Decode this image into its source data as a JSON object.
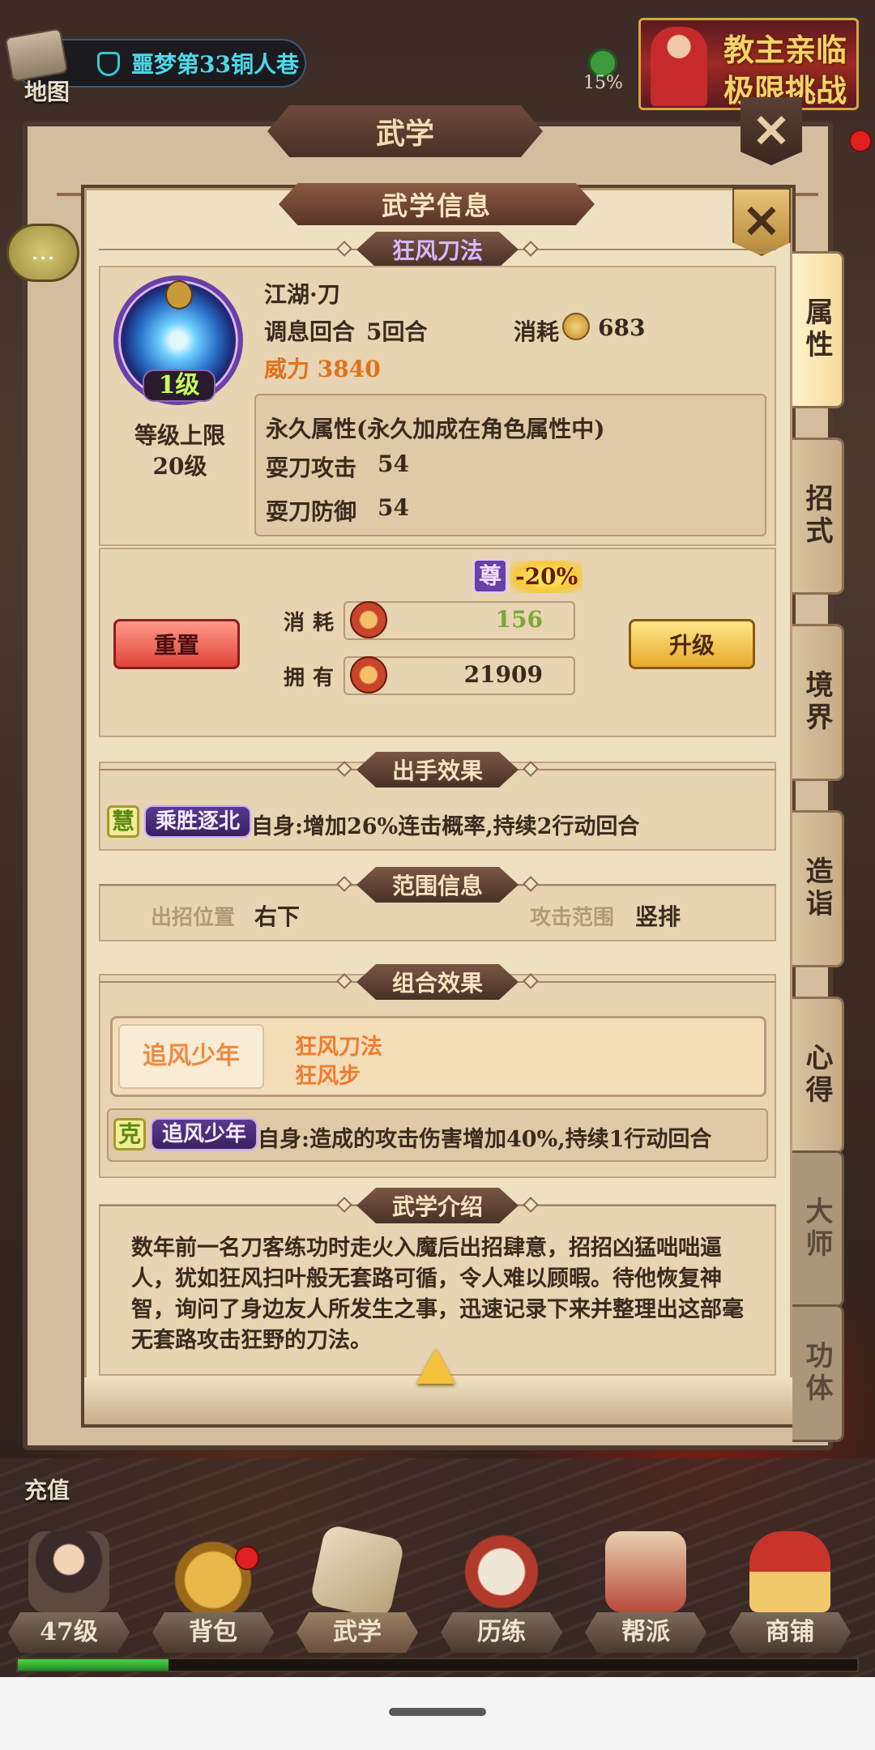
{
  "hud": {
    "map_label": "地图",
    "location": "噩梦第33铜人巷",
    "percent": "15%",
    "event_line1": "教主亲临",
    "event_line2": "极限挑战",
    "recharge_label": "充值",
    "chat_icon": "…"
  },
  "back_window": {
    "title": "武学",
    "close_symbol": "✕"
  },
  "dialog": {
    "title": "武学信息",
    "close_symbol": "✕",
    "skill_name": "狂风刀法",
    "info": {
      "level_badge": "1级",
      "level_cap_label": "等级上限",
      "level_cap_value": "20级",
      "school": "江湖·刀",
      "breath_label": "调息回合",
      "breath_value": "5回合",
      "cost_label": "消耗",
      "cost_value": "683",
      "power": "威力 3840",
      "permanent_title": "永久属性(永久加成在角色属性中)",
      "stat1_label": "耍刀攻击",
      "stat1_value": "54",
      "stat2_label": "耍刀防御",
      "stat2_value": "54"
    },
    "upgrade": {
      "reset_label": "重置",
      "upgrade_label": "升级",
      "rank_badge": "尊",
      "discount": "-20%",
      "consume_label": "消耗",
      "consume_value": "156",
      "own_label": "拥有",
      "own_value": "21909"
    },
    "attack_effect": {
      "header": "出手效果",
      "tag_char": "慧",
      "tag_name": "乘胜逐北",
      "text": "自身:增加26%连击概率,持续2行动回合"
    },
    "range_info": {
      "header": "范围信息",
      "position_label": "出招位置",
      "position_value": "右下",
      "area_label": "攻击范围",
      "area_value": "竖排"
    },
    "combo": {
      "header": "组合效果",
      "name": "追风少年",
      "member1": "狂风刀法",
      "member2": "狂风步",
      "tag_char": "克",
      "tag_name": "追风少年",
      "text": "自身:造成的攻击伤害增加40%,持续1行动回合"
    },
    "intro": {
      "header": "武学介绍",
      "text": "数年前一名刀客练功时走火入魔后出招肆意，招招凶猛咄咄逼人，犹如狂风扫叶般无套路可循，令人难以顾暇。待他恢复神智，询问了身边友人所发生之事，迅速记录下来并整理出这部毫无套路攻击狂野的刀法。"
    }
  },
  "side_tabs": [
    "属性",
    "招式",
    "境界",
    "造诣",
    "心得",
    "大师",
    "功体"
  ],
  "bottom_nav": [
    "47级",
    "背包",
    "武学",
    "历练",
    "帮派",
    "商铺"
  ],
  "exp_progress": 0.18,
  "colors": {
    "panel_bg": "#efe0c2",
    "power_orange": "#e0721a",
    "consume_green": "#7aa83a",
    "accent_purple": "#6a3fa8"
  }
}
